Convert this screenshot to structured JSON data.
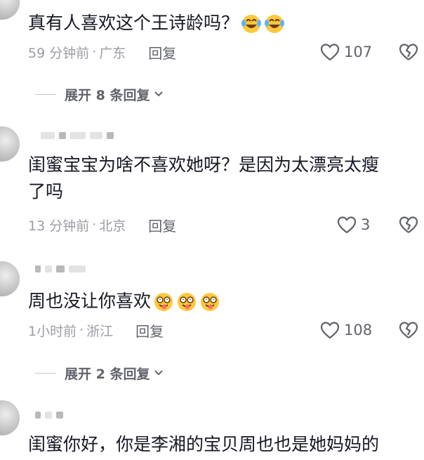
{
  "comments": [
    {
      "text": "真有人喜欢这个王诗龄吗？",
      "time": "59 分钟前",
      "location": "广东",
      "reply_label": "回复",
      "likes": "107",
      "emoji": "tears-of-joy"
    },
    {
      "text": "闺蜜宝宝为啥不喜欢她呀？是因为太漂亮太瘦\n了吗",
      "time": "13 分钟前",
      "location": "北京",
      "reply_label": "回复",
      "likes": "3"
    },
    {
      "text": "周也没让你喜欢",
      "time": "1小时前",
      "location": "浙江",
      "reply_label": "回复",
      "likes": "108",
      "emoji": "dizzy-tongue-face"
    },
    {
      "text": "闺蜜你好，你是李湘的宝贝周也也是她妈妈的"
    }
  ],
  "expand_replies": [
    {
      "label": "展开 8 条回复"
    },
    {
      "label": "展开 2 条回复"
    }
  ],
  "separator": "·",
  "colors": {
    "text": "#161823",
    "meta": "#9b9ca3",
    "action": "#61636b"
  }
}
